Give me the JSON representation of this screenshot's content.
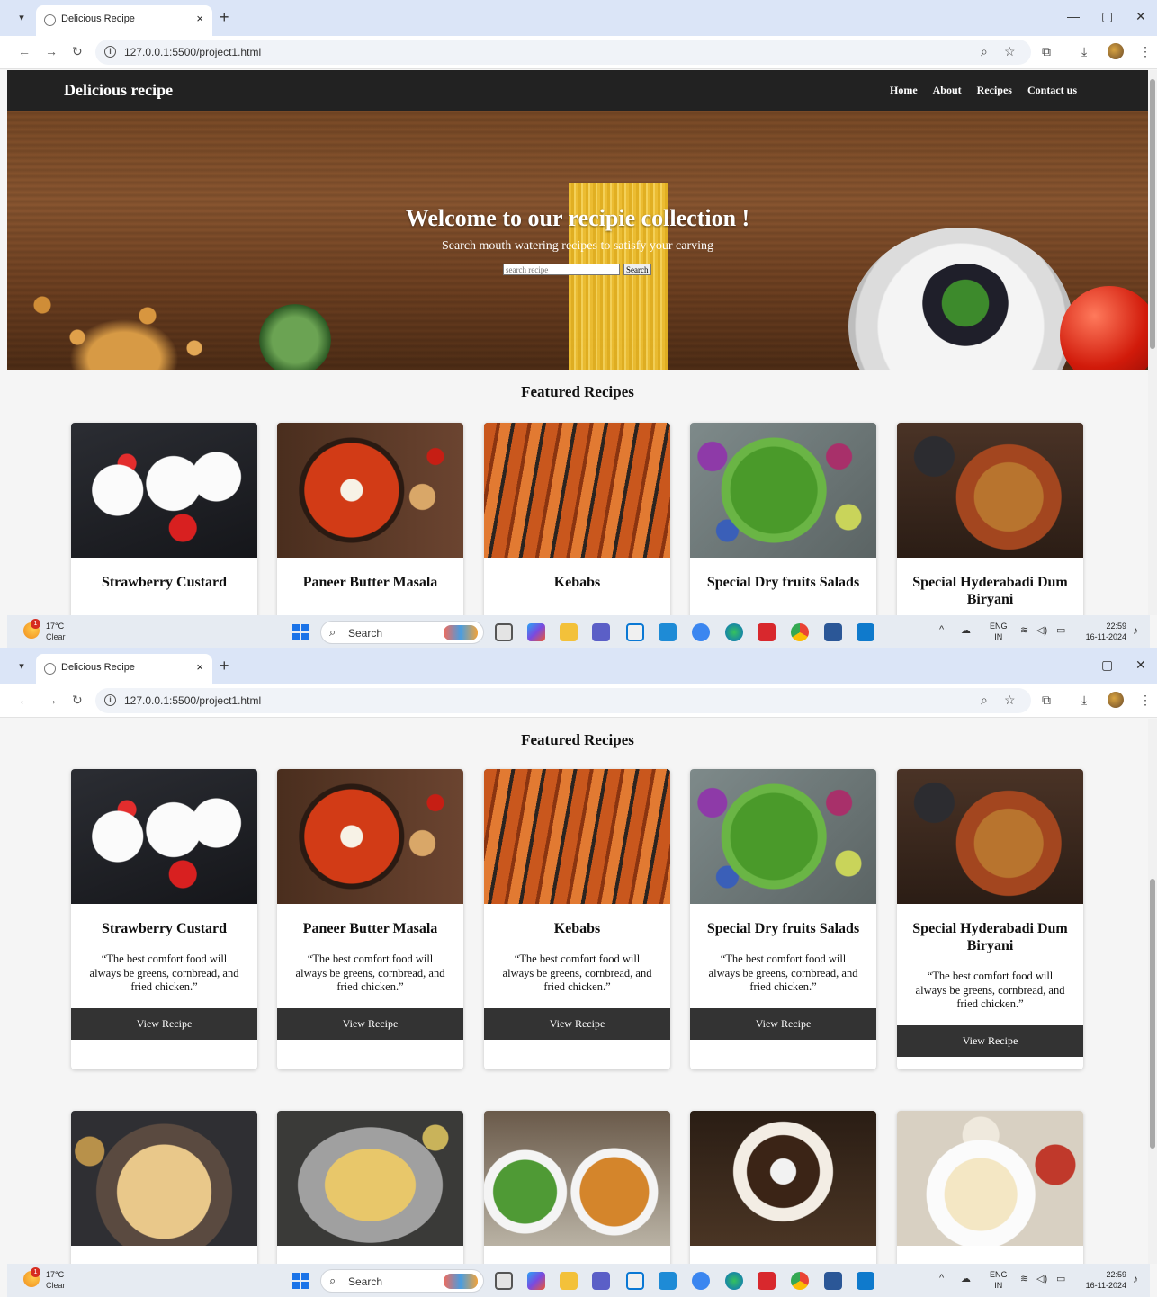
{
  "browser": {
    "tab_title": "Delicious Recipe",
    "url": "127.0.0.1:5500/project1.html",
    "new_tab": "+",
    "close_tab": "×",
    "controls": {
      "minimize": "—",
      "restore": "▢",
      "close": "✕"
    }
  },
  "site": {
    "brand": "Delicious recipe",
    "nav": [
      "Home",
      "About",
      "Recipes",
      "Contact us"
    ],
    "hero": {
      "title": "Welcome to our recipie collection !",
      "subtitle": "Search mouth watering recipes to satisfy your carving",
      "search_placeholder": "search recipe",
      "search_button": "Search"
    },
    "featured_title": "Featured Recipes",
    "cards": [
      {
        "title": "Strawberry Custard",
        "text": "“The best comfort food will always be greens, cornbread, and fried chicken.”",
        "button": "View Recipe"
      },
      {
        "title": "Paneer Butter Masala",
        "text": "“The best comfort food will always be greens, cornbread, and fried chicken.”",
        "button": "View Recipe"
      },
      {
        "title": "Kebabs",
        "text": "“The best comfort food will always be greens, cornbread, and fried chicken.”",
        "button": "View Recipe"
      },
      {
        "title": "Special Dry fruits Salads",
        "text": "“The best comfort food will always be greens, cornbread, and fried chicken.”",
        "button": "View Recipe"
      },
      {
        "title": "Special Hyderabadi Dum Biryani",
        "text": "“The best comfort food will always be greens, cornbread, and fried chicken.”",
        "button": "View Recipe"
      }
    ]
  },
  "taskbar": {
    "weather_temp": "17°C",
    "weather_cond": "Clear",
    "weather_badge": "1",
    "search": "Search",
    "lang_1": "ENG",
    "lang_2": "IN",
    "time": "22:59",
    "date": "16-11-2024"
  },
  "icons": [
    "chevron-down-icon",
    "globe-icon",
    "back-icon",
    "forward-icon",
    "reload-icon",
    "info-icon",
    "zoom-icon",
    "star-icon",
    "extensions-icon",
    "download-icon",
    "profile-icon",
    "more-icon",
    "start-icon",
    "search-icon",
    "wifi-icon",
    "volume-icon",
    "battery-icon",
    "bell-icon"
  ],
  "colors": {
    "header_bg": "#222222",
    "button_bg": "#333333",
    "page_bg": "#f5f5f5",
    "tabstrip_bg": "#dbe5f7"
  }
}
